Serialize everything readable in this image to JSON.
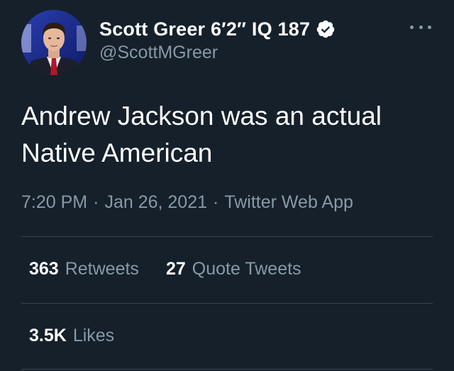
{
  "author": {
    "display_name": "Scott Greer 6′2″ IQ 187",
    "handle": "@ScottMGreer",
    "verified": true
  },
  "tweet": {
    "text": "Andrew Jackson was an actual\nNative American",
    "time": "7:20 PM",
    "date": "Jan 26, 2021",
    "source": "Twitter Web App",
    "separator": "·"
  },
  "stats": {
    "retweets": {
      "count": "363",
      "label": "Retweets"
    },
    "quote_tweets": {
      "count": "27",
      "label": "Quote Tweets"
    },
    "likes": {
      "count": "3.5K",
      "label": "Likes"
    }
  },
  "icons": {
    "verified": "verified-badge-icon",
    "more": "more-horizontal-icon"
  },
  "colors": {
    "background": "#15202b",
    "primary_text": "#ffffff",
    "secondary_text": "#8899a6",
    "divider": "#38444d"
  }
}
